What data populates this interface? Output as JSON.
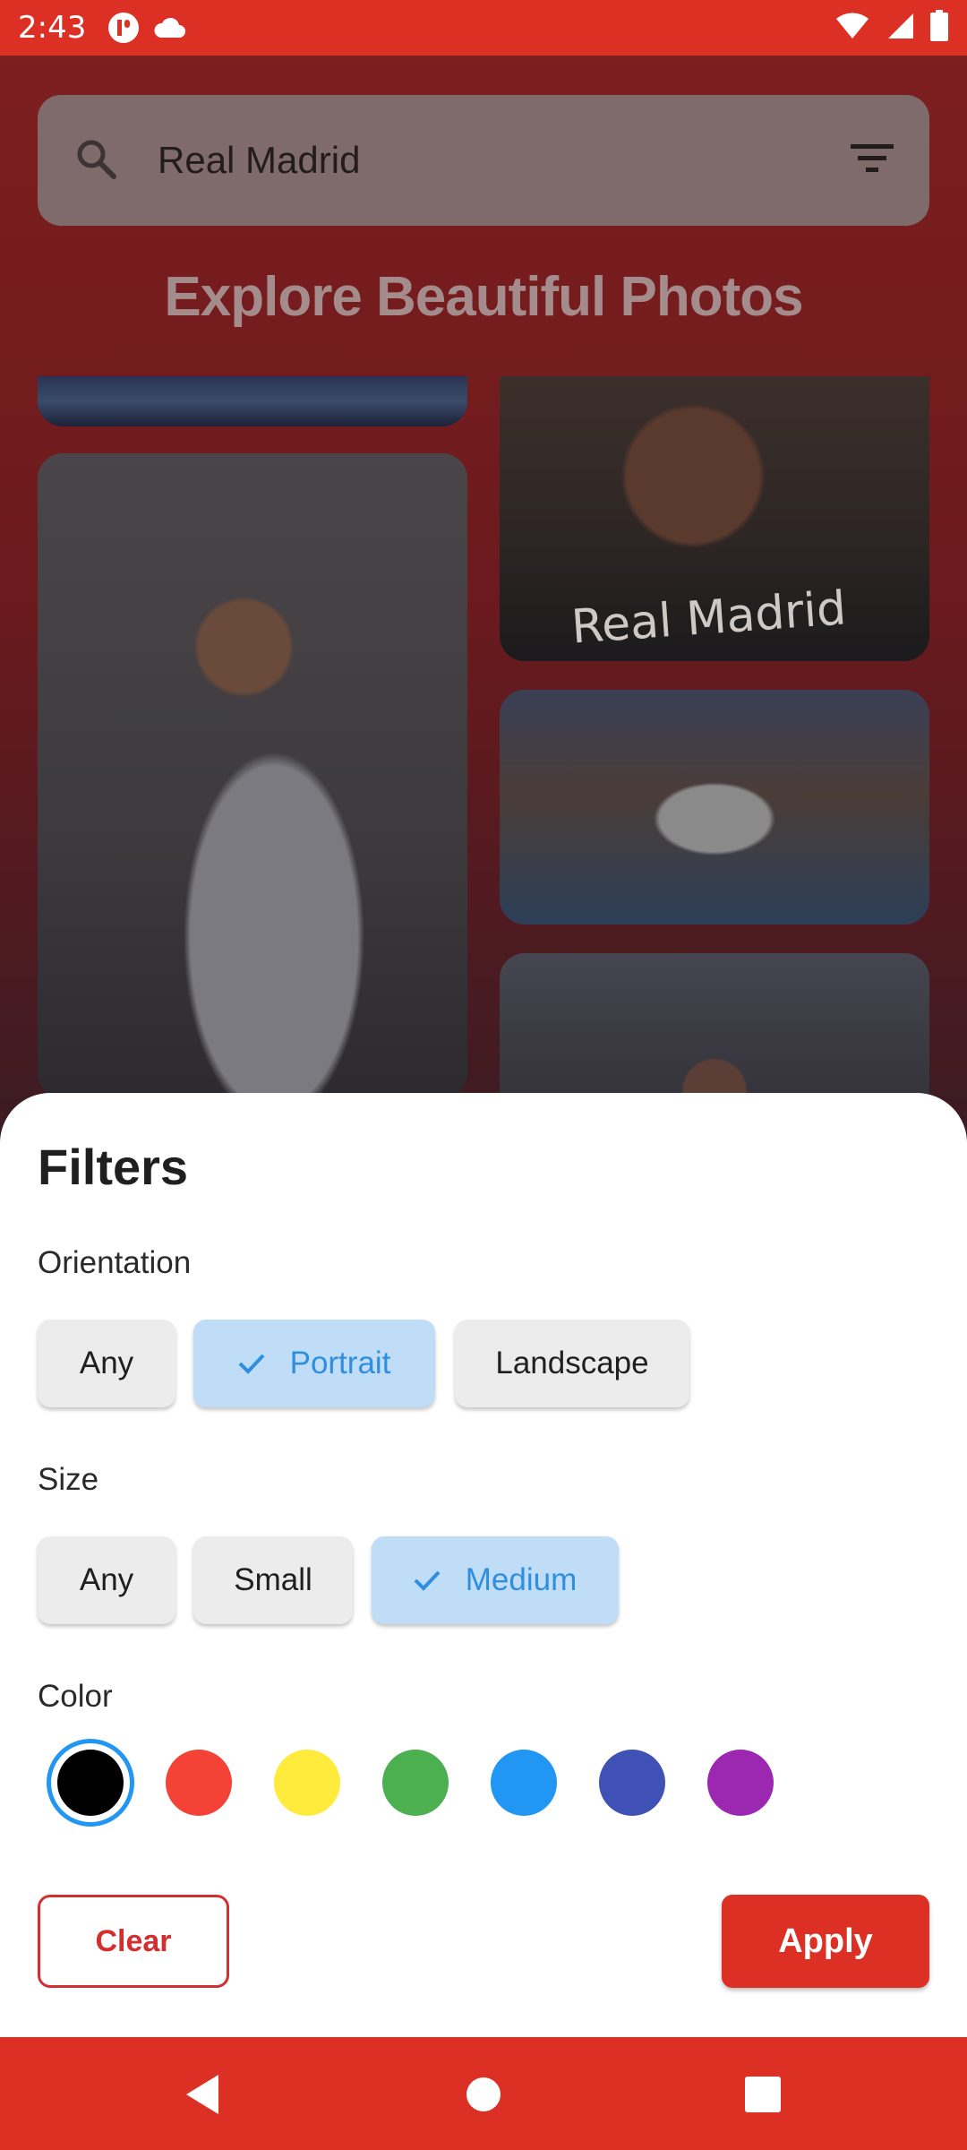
{
  "status_bar": {
    "time": "2:43",
    "icons": [
      "app-notification-icon",
      "cloud-icon",
      "wifi-icon",
      "signal-icon",
      "battery-icon"
    ]
  },
  "search": {
    "query": "Real Madrid"
  },
  "page": {
    "title": "Explore Beautiful Photos"
  },
  "photos": {
    "shirt_text": "Real Madrid"
  },
  "filters": {
    "title": "Filters",
    "orientation": {
      "label": "Orientation",
      "options": [
        "Any",
        "Portrait",
        "Landscape"
      ],
      "selected": "Portrait"
    },
    "size": {
      "label": "Size",
      "options": [
        "Any",
        "Small",
        "Medium"
      ],
      "selected": "Medium"
    },
    "color": {
      "label": "Color",
      "swatches": [
        "#000000",
        "#f44336",
        "#ffeb3b",
        "#4caf50",
        "#2196f3",
        "#3f51b5",
        "#9c27b0"
      ],
      "selected": "#000000"
    },
    "clear_label": "Clear",
    "apply_label": "Apply"
  },
  "colors": {
    "accent": "#dc3024",
    "chip_selected_bg": "#bfddf6",
    "chip_selected_text": "#2f8ee0"
  }
}
